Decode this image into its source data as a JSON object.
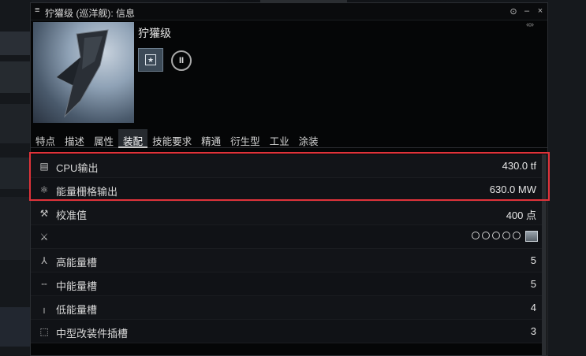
{
  "window": {
    "title": "狞獾级 (巡洋舰): 信息",
    "menu_icon": "menu-icon",
    "controls": [
      "⊙",
      "–",
      "×"
    ]
  },
  "ship": {
    "name": "狞獾级",
    "collapse": "«»"
  },
  "tabs": [
    "特点",
    "描述",
    "属性",
    "装配",
    "技能要求",
    "精通",
    "衍生型",
    "工业",
    "涂装"
  ],
  "active_tab": "装配",
  "rows": [
    {
      "icon": "cpu-icon",
      "glyph": "▤",
      "label": "CPU输出",
      "value": "430.0 tf"
    },
    {
      "icon": "powergrid-icon",
      "glyph": "⚛",
      "label": "能量栅格输出",
      "value": "630.0 MW"
    },
    {
      "icon": "calibration-icon",
      "glyph": "⚒",
      "label": "校准值",
      "value": "400 点"
    },
    {
      "icon": "turret-icon",
      "glyph": "⚔",
      "label": "",
      "value": ""
    },
    {
      "icon": "high-slot-icon",
      "glyph": "⅄",
      "label": "高能量槽",
      "value": "5"
    },
    {
      "icon": "mid-slot-icon",
      "glyph": "╌",
      "label": "中能量槽",
      "value": "5"
    },
    {
      "icon": "low-slot-icon",
      "glyph": "╷",
      "label": "低能量槽",
      "value": "4"
    },
    {
      "icon": "rig-slot-icon",
      "glyph": "⬚",
      "label": "中型改装件插槽",
      "value": "3"
    }
  ],
  "colors": {
    "highlight": "#e0333a",
    "background": "#050607"
  }
}
